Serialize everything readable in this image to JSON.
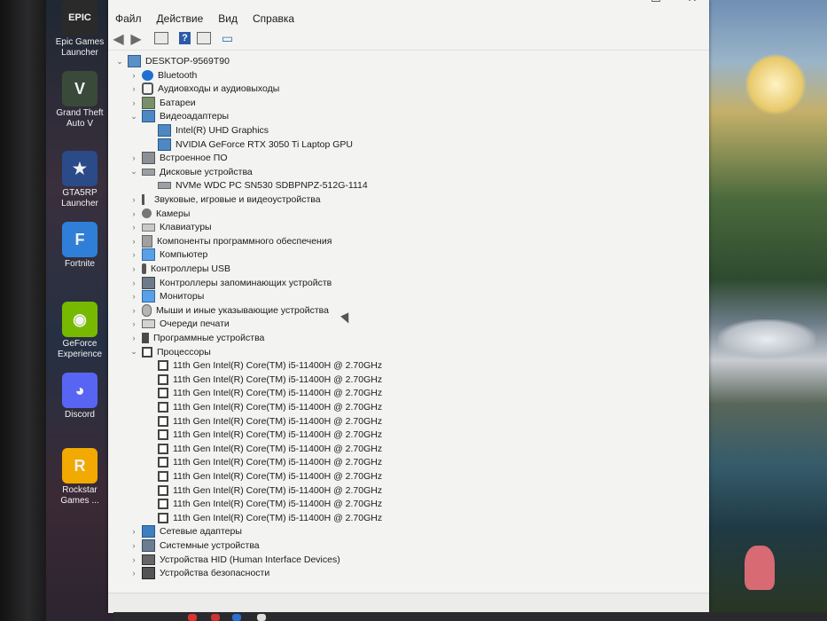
{
  "desktop": {
    "icons": [
      {
        "label": "Epic Games Launcher",
        "glyph": "EPIC",
        "color": "#2a2a2a"
      },
      {
        "label": "Grand Theft Auto V",
        "glyph": "V",
        "color": "#3a4a3a"
      },
      {
        "label": "GTA5RP Launcher",
        "glyph": "★",
        "color": "#2b4a88"
      },
      {
        "label": "Fortnite",
        "glyph": "F",
        "color": "#2f7fd8"
      },
      {
        "label": "GeForce Experience",
        "glyph": "◉",
        "color": "#76b900"
      },
      {
        "label": "Discord",
        "glyph": "◕",
        "color": "#5865f2"
      },
      {
        "label": "Rockstar Games ...",
        "glyph": "R",
        "color": "#f2a900"
      }
    ]
  },
  "window": {
    "title_controls": {
      "minimize": "—",
      "maximize": "☐",
      "close": "✕"
    },
    "menu": [
      "Файл",
      "Действие",
      "Вид",
      "Справка"
    ],
    "toolbar": {
      "back": "◀",
      "forward": "▶",
      "help": "?"
    }
  },
  "tree": {
    "root": "DESKTOP-9569T90",
    "nodes": [
      {
        "label": "Bluetooth",
        "expanded": false,
        "icon": "bt"
      },
      {
        "label": "Аудиовходы и аудиовыходы",
        "expanded": false,
        "icon": "audio"
      },
      {
        "label": "Батареи",
        "expanded": false,
        "icon": "battery"
      },
      {
        "label": "Видеоадаптеры",
        "expanded": true,
        "icon": "display",
        "children": [
          "Intel(R) UHD Graphics",
          "NVIDIA GeForce RTX 3050 Ti Laptop GPU"
        ]
      },
      {
        "label": "Встроенное ПО",
        "expanded": false,
        "icon": "firmware"
      },
      {
        "label": "Дисковые устройства",
        "expanded": true,
        "icon": "disk",
        "children": [
          "NVMe WDC PC SN530 SDBPNPZ-512G-1114"
        ]
      },
      {
        "label": "Звуковые, игровые и видеоустройства",
        "expanded": false,
        "icon": "sound"
      },
      {
        "label": "Камеры",
        "expanded": false,
        "icon": "camera"
      },
      {
        "label": "Клавиатуры",
        "expanded": false,
        "icon": "keyboard"
      },
      {
        "label": "Компоненты программного обеспечения",
        "expanded": false,
        "icon": "software"
      },
      {
        "label": "Компьютер",
        "expanded": false,
        "icon": "monitor"
      },
      {
        "label": "Контроллеры USB",
        "expanded": false,
        "icon": "usb"
      },
      {
        "label": "Контроллеры запоминающих устройств",
        "expanded": false,
        "icon": "storage"
      },
      {
        "label": "Мониторы",
        "expanded": false,
        "icon": "monitor"
      },
      {
        "label": "Мыши и иные указывающие устройства",
        "expanded": false,
        "icon": "mouse"
      },
      {
        "label": "Очереди печати",
        "expanded": false,
        "icon": "print"
      },
      {
        "label": "Программные устройства",
        "expanded": false,
        "icon": "progdev"
      },
      {
        "label": "Процессоры",
        "expanded": true,
        "icon": "cpu",
        "children": [
          "11th Gen Intel(R) Core(TM) i5-11400H @ 2.70GHz",
          "11th Gen Intel(R) Core(TM) i5-11400H @ 2.70GHz",
          "11th Gen Intel(R) Core(TM) i5-11400H @ 2.70GHz",
          "11th Gen Intel(R) Core(TM) i5-11400H @ 2.70GHz",
          "11th Gen Intel(R) Core(TM) i5-11400H @ 2.70GHz",
          "11th Gen Intel(R) Core(TM) i5-11400H @ 2.70GHz",
          "11th Gen Intel(R) Core(TM) i5-11400H @ 2.70GHz",
          "11th Gen Intel(R) Core(TM) i5-11400H @ 2.70GHz",
          "11th Gen Intel(R) Core(TM) i5-11400H @ 2.70GHz",
          "11th Gen Intel(R) Core(TM) i5-11400H @ 2.70GHz",
          "11th Gen Intel(R) Core(TM) i5-11400H @ 2.70GHz",
          "11th Gen Intel(R) Core(TM) i5-11400H @ 2.70GHz"
        ]
      },
      {
        "label": "Сетевые адаптеры",
        "expanded": false,
        "icon": "network"
      },
      {
        "label": "Системные устройства",
        "expanded": false,
        "icon": "system"
      },
      {
        "label": "Устройства HID (Human Interface Devices)",
        "expanded": false,
        "icon": "hid"
      },
      {
        "label": "Устройства безопасности",
        "expanded": false,
        "icon": "security"
      }
    ]
  }
}
